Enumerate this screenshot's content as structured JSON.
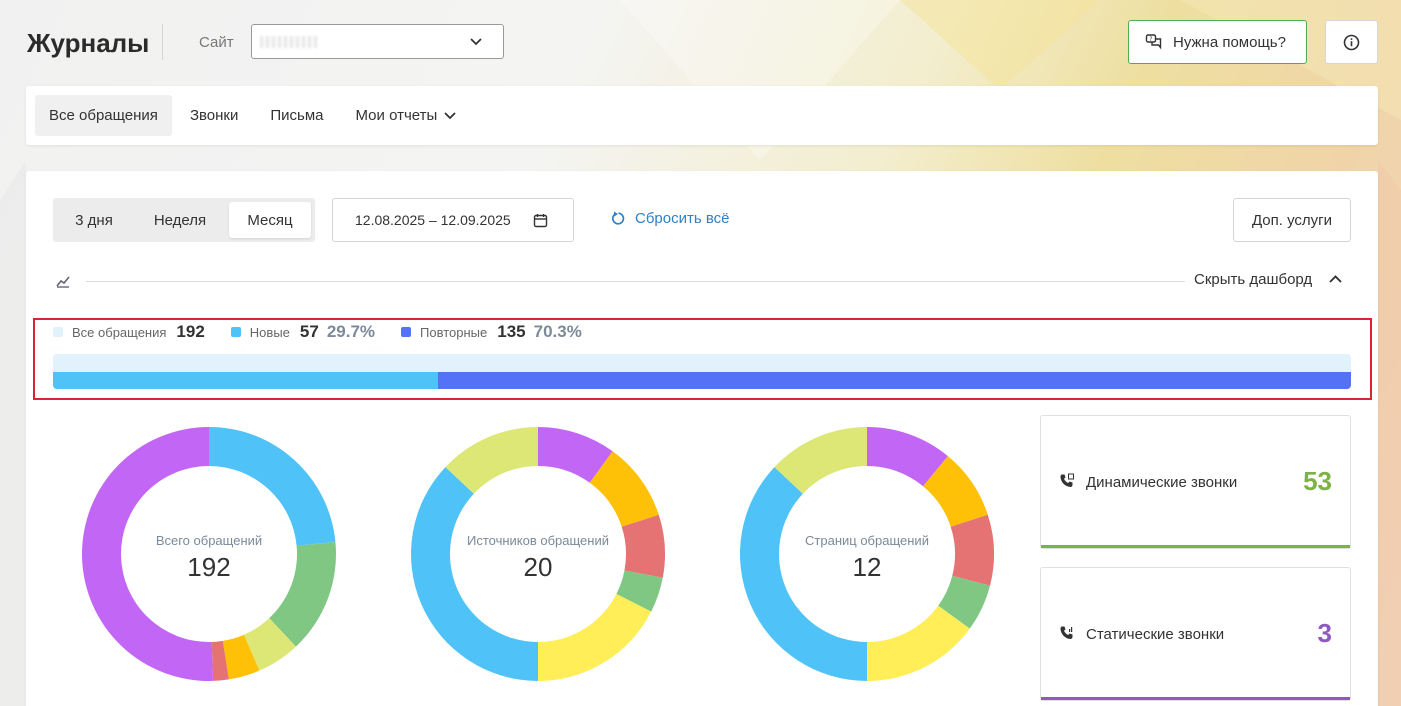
{
  "header": {
    "title": "Журналы",
    "site_label": "Сайт",
    "help_label": "Нужна помощь?"
  },
  "tabs": [
    {
      "label": "Все обращения",
      "active": true
    },
    {
      "label": "Звонки"
    },
    {
      "label": "Письма"
    },
    {
      "label": "Мои отчеты"
    }
  ],
  "filters": {
    "periods": [
      {
        "label": "3 дня"
      },
      {
        "label": "Неделя"
      },
      {
        "label": "Месяц",
        "active": true
      }
    ],
    "date_range": "12.08.2025 – 12.09.2025",
    "reset_label": "Сбросить всё",
    "extra_label": "Доп. услуги"
  },
  "dashboard": {
    "hide_label": "Скрыть дашборд"
  },
  "legend": {
    "all": {
      "label": "Все обращения",
      "value": "192",
      "color": "#e2f2fc"
    },
    "new": {
      "label": "Новые",
      "value": "57",
      "percent": "29.7%",
      "color": "#4fc3f7"
    },
    "repeat": {
      "label": "Повторные",
      "value": "135",
      "percent": "70.3%",
      "color": "#5472f5"
    }
  },
  "colors": {
    "accent_blue": "#2f80c5",
    "accent_green": "#4caf50",
    "highlight_red": "#d8262e"
  },
  "donuts": [
    {
      "label": "Всего обращений",
      "value": "192",
      "segments": [
        {
          "v": 0.235,
          "c": "#4fc3f7"
        },
        {
          "v": 0.145,
          "c": "#81c784"
        },
        {
          "v": 0.055,
          "c": "#dce775"
        },
        {
          "v": 0.04,
          "c": "#ffc107"
        },
        {
          "v": 0.02,
          "c": "#e57373"
        },
        {
          "v": 0.505,
          "c": "#c266f5"
        }
      ]
    },
    {
      "label": "Источников обращений",
      "value": "20",
      "segments": [
        {
          "v": 0.1,
          "c": "#c266f5"
        },
        {
          "v": 0.1,
          "c": "#ffc107"
        },
        {
          "v": 0.08,
          "c": "#e57373"
        },
        {
          "v": 0.045,
          "c": "#81c784"
        },
        {
          "v": 0.175,
          "c": "#ffee58"
        },
        {
          "v": 0.37,
          "c": "#4fc3f7"
        },
        {
          "v": 0.13,
          "c": "#dce775"
        }
      ]
    },
    {
      "label": "Страниц обращений",
      "value": "12",
      "segments": [
        {
          "v": 0.11,
          "c": "#c266f5"
        },
        {
          "v": 0.09,
          "c": "#ffc107"
        },
        {
          "v": 0.09,
          "c": "#e57373"
        },
        {
          "v": 0.06,
          "c": "#81c784"
        },
        {
          "v": 0.15,
          "c": "#ffee58"
        },
        {
          "v": 0.37,
          "c": "#4fc3f7"
        },
        {
          "v": 0.13,
          "c": "#dce775"
        }
      ]
    }
  ],
  "cards": [
    {
      "label": "Динамические звонки",
      "value": "53",
      "color": "#7cb342"
    },
    {
      "label": "Статические звонки",
      "value": "3",
      "color": "#8e59c2"
    }
  ]
}
